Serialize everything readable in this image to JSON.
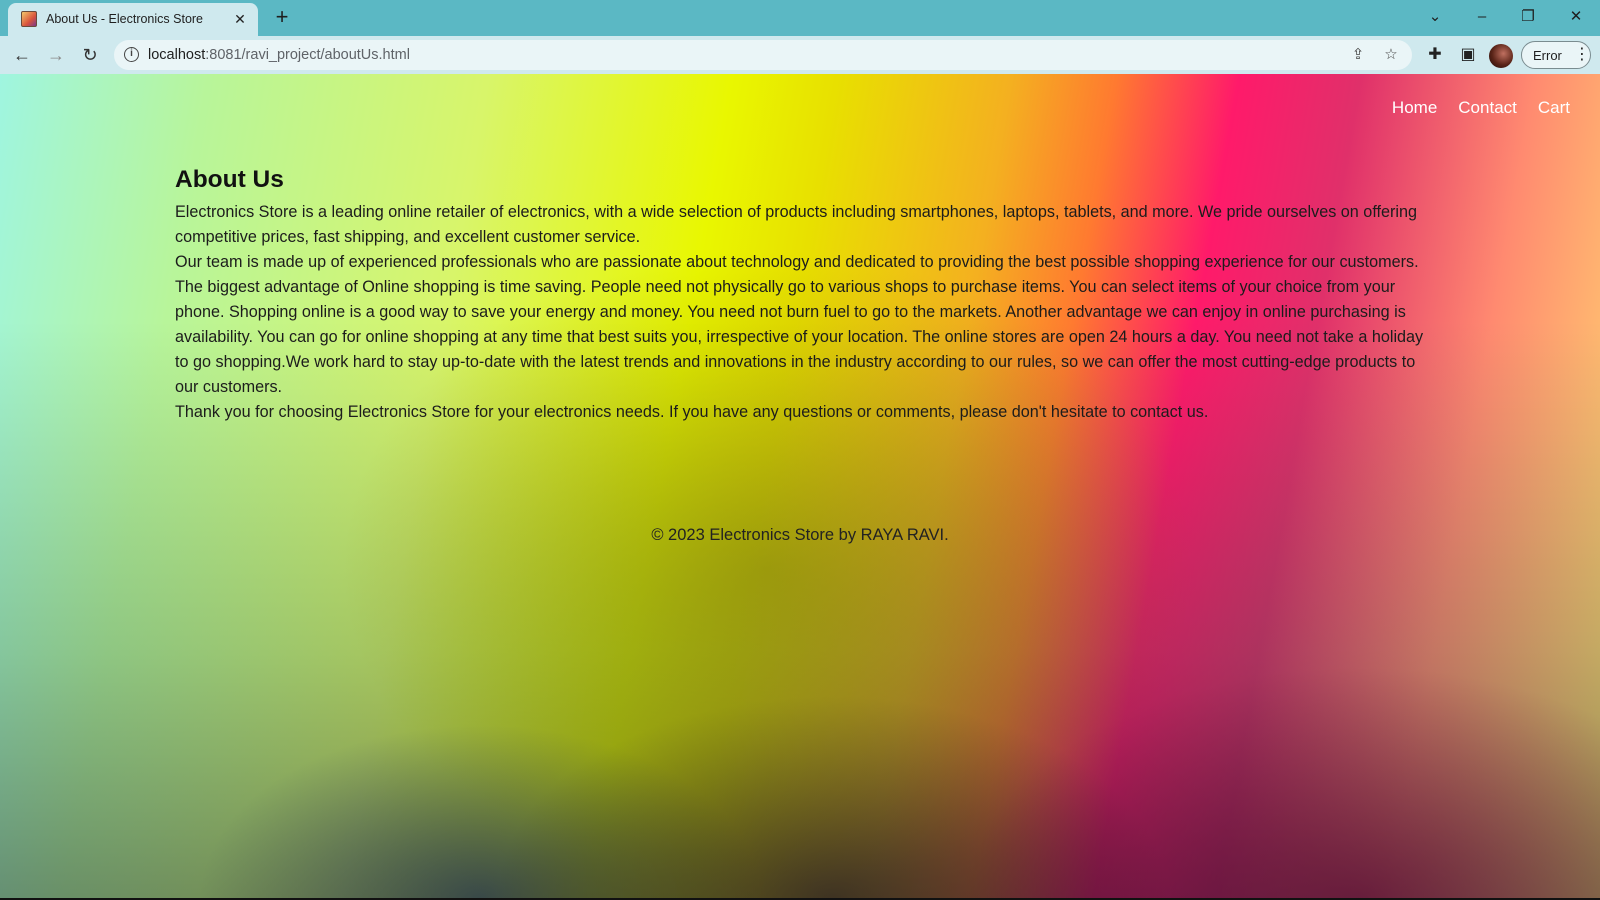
{
  "browser": {
    "tab": {
      "title": "About Us - Electronics Store",
      "favicon": "store-favicon-icon",
      "close_icon": "close-icon"
    },
    "new_tab_icon": "plus-icon",
    "window_controls": [
      "chevron-down-icon",
      "minimize-icon",
      "restore-icon",
      "close-icon"
    ],
    "address_bar": {
      "url_host": "localhost",
      "url_rest": ":8081/ravi_project/aboutUs.html",
      "info_icon": "info-icon",
      "share_icon": "share-icon",
      "bookmark_icon": "star-icon"
    },
    "toolbar_icons": [
      "extensions-icon",
      "side-panel-icon"
    ],
    "profile_error_label": "Error",
    "menu_icon": "more-vert-icon"
  },
  "site": {
    "nav": [
      {
        "label": "Home"
      },
      {
        "label": "Contact"
      },
      {
        "label": "Cart"
      }
    ],
    "about": {
      "heading": "About Us",
      "paragraphs": [
        "Electronics Store is a leading online retailer of electronics, with a wide selection of products including smartphones, laptops, tablets, and more. We pride ourselves on offering competitive prices, fast shipping, and excellent customer service.",
        "Our team is made up of experienced professionals who are passionate about technology and dedicated to providing the best possible shopping experience for our customers. The biggest advantage of Online shopping is time saving. People need not physically go to various shops to purchase items. You can select items of your choice from your phone. Shopping online is a good way to save your energy and money. You need not burn fuel to go to the markets. Another advantage we can enjoy in online purchasing is availability. You can go for online shopping at any time that best suits you, irrespective of your location. The online stores are open 24 hours a day. You need not take a holiday to go shopping.We work hard to stay up-to-date with the latest trends and innovations in the industry according to our rules, so we can offer the most cutting-edge products to our customers.",
        "Thank you for choosing Electronics Store for your electronics needs. If you have any questions or comments, please don't hesitate to contact us."
      ]
    },
    "footer": "© 2023 Electronics Store by RAYA RAVI."
  },
  "colors": {
    "tabstrip": "#5bb8c4",
    "toolbar": "#cfe9ee",
    "nav_link": "#ffffff"
  }
}
